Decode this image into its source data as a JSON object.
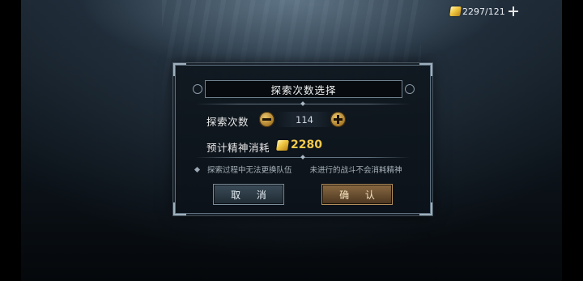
{
  "currency": {
    "icon": "gold-ingot-icon",
    "value": "2297/121",
    "add_icon": "plus-icon"
  },
  "dialog": {
    "title": "探索次数选择",
    "count_label": "探索次数",
    "count_value": "114",
    "cost_label": "预计精神消耗",
    "cost_value": "2280",
    "note_1": "探索过程中无法更换队伍",
    "note_2": "未进行的战斗不会消耗精神",
    "cancel_label": "取 消",
    "confirm_label": "确 认"
  },
  "colors": {
    "gold": "#f2c94c",
    "panel_border": "#5f7180"
  }
}
